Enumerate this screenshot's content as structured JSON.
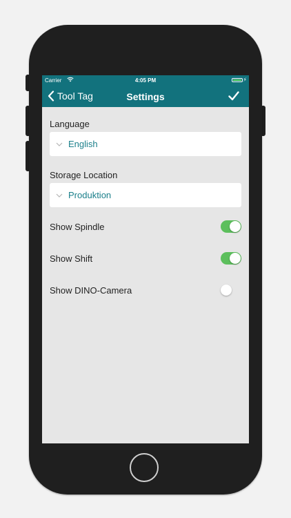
{
  "status_bar": {
    "carrier": "Carrier",
    "time": "4:05 PM"
  },
  "nav": {
    "back_label": "Tool Tag",
    "title": "Settings"
  },
  "settings": {
    "language": {
      "label": "Language",
      "value": "English"
    },
    "storage_location": {
      "label": "Storage Location",
      "value": "Produktion"
    },
    "toggles": [
      {
        "label": "Show Spindle",
        "on": true
      },
      {
        "label": "Show Shift",
        "on": true
      },
      {
        "label": "Show DINO-Camera",
        "on": false
      }
    ]
  },
  "colors": {
    "header": "#12727d",
    "accent_text": "#1a7f8a",
    "switch_on": "#5cbf5c",
    "background": "#e6e6e6"
  }
}
